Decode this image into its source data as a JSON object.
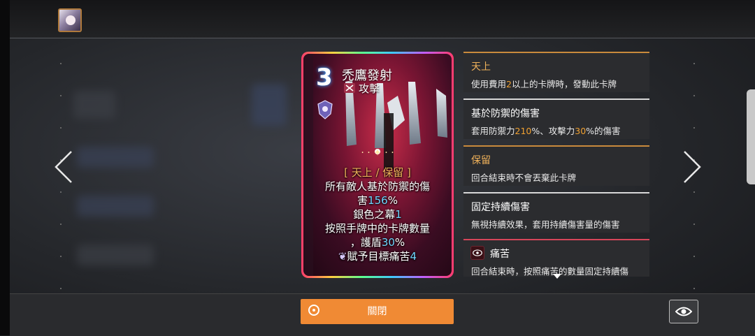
{
  "card": {
    "cost": "3",
    "name": "禿鷹發射",
    "type": "攻擊",
    "text": {
      "keywords": "[ 天上 / 保留 ]",
      "line1a": "所有敵人基於防禦的傷",
      "line2a": "害",
      "line2num": "156",
      "line2b": "%",
      "line3a": "銀色之幕",
      "line3num": "1",
      "line4a": "按照手牌中的卡牌數量",
      "line5a": "，護盾",
      "line5num": "30",
      "line5b": "%",
      "line6a": "賦予目標痛苦",
      "line6num": "4"
    }
  },
  "keywords": [
    {
      "title": "天上",
      "desc_a": "使用費用",
      "desc_hl": "2",
      "desc_b": "以上的卡牌時，發動此卡牌",
      "accent": "#c98a3c"
    },
    {
      "title": "基於防禦的傷害",
      "desc_a": "套用防禦力",
      "desc_hl": "210",
      "desc_b": "%、攻擊力",
      "desc_hl2": "30",
      "desc_c": "%的傷害",
      "accent": "#d8d8d8"
    },
    {
      "title": "保留",
      "desc_a": "回合結束時不會丟棄此卡牌",
      "accent": "#c98a3c"
    },
    {
      "title": "固定持續傷害",
      "desc_a": "無視持續效果，套用持續傷害量的傷害",
      "accent": "#d8d8d8"
    },
    {
      "title": "痛苦",
      "desc_a": "回合結束時，按照痛苦的數量固定持續傷",
      "accent": "#d6465a"
    }
  ],
  "buttons": {
    "close_label": "關閉"
  },
  "icons": {
    "close": "target-circle-icon",
    "view": "eye-icon",
    "prev": "chevron-left-icon",
    "next": "chevron-right-icon",
    "type": "crossed-swords-icon",
    "rarity": "shield-crest-icon",
    "status": "eye-badge-icon"
  },
  "colors": {
    "accent_orange": "#f08a34",
    "keyword_gold": "#f0b25a",
    "number_cyan": "#6fd6ff",
    "highlight_orange": "#f0a030"
  }
}
